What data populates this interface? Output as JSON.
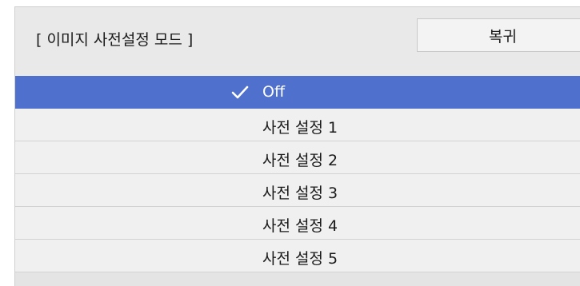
{
  "header": {
    "title": "[ 이미지 사전설정 모드 ]",
    "reset_label": "복귀"
  },
  "options": [
    {
      "label": "Off",
      "selected": true
    },
    {
      "label": "사전 설정 1",
      "selected": false
    },
    {
      "label": "사전 설정 2",
      "selected": false
    },
    {
      "label": "사전 설정 3",
      "selected": false
    },
    {
      "label": "사전 설정 4",
      "selected": false
    },
    {
      "label": "사전 설정 5",
      "selected": false
    }
  ],
  "colors": {
    "selected_background": "#4f70cc",
    "selected_text": "#ffffff",
    "row_background": "#f0f0f0"
  },
  "icons": {
    "selected_marker": "check-icon"
  }
}
